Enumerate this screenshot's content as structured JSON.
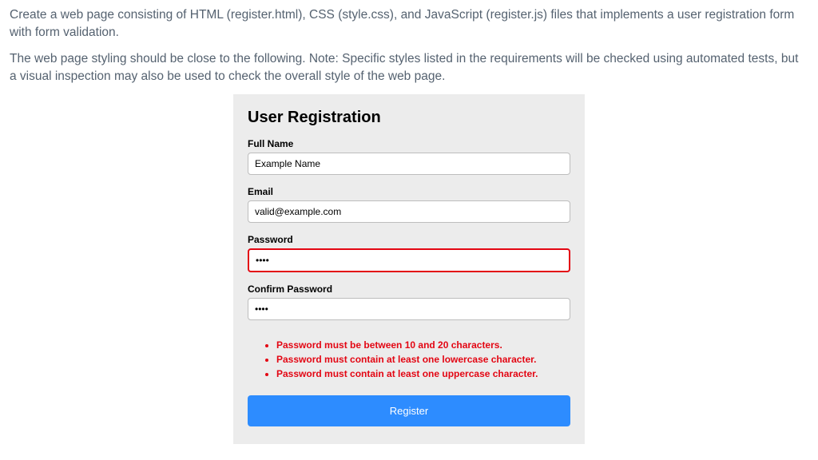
{
  "intro": {
    "p1": "Create a web page consisting of HTML (register.html), CSS (style.css), and JavaScript (register.js) files that implements a user registration form with form validation.",
    "p2": "The web page styling should be close to the following. Note: Specific styles listed in the requirements will be checked using automated tests, but a visual inspection may also be used to check the overall style of the web page."
  },
  "form": {
    "title": "User Registration",
    "fullName": {
      "label": "Full Name",
      "value": "Example Name"
    },
    "email": {
      "label": "Email",
      "value": "valid@example.com"
    },
    "password": {
      "label": "Password",
      "value": "••••"
    },
    "confirmPassword": {
      "label": "Confirm Password",
      "value": "••••"
    },
    "errors": [
      "Password must be between 10 and 20 characters.",
      "Password must contain at least one lowercase character.",
      "Password must contain at least one uppercase character."
    ],
    "submitLabel": "Register"
  }
}
